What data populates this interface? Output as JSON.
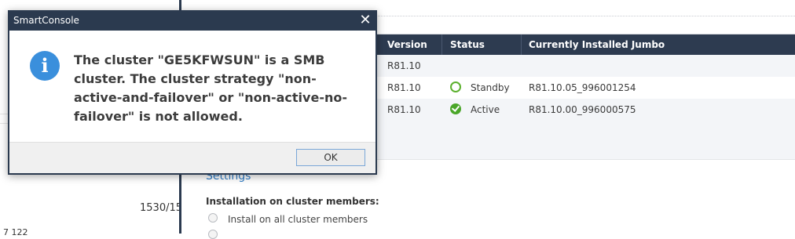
{
  "left_panel": {
    "page_number": "1530/15",
    "fragment_text": "7 122"
  },
  "table": {
    "columns": [
      "Version",
      "Status",
      "Currently Installed Jumbo"
    ],
    "rows": [
      {
        "version": "R81.10",
        "status": "",
        "status_icon": "",
        "jumbo": ""
      },
      {
        "version": "R81.10",
        "status": "Standby",
        "status_icon": "standby-circle-icon",
        "jumbo": "R81.10.05_996001254"
      },
      {
        "version": "R81.10",
        "status": "Active",
        "status_icon": "active-check-icon",
        "jumbo": "R81.10.00_996000575"
      }
    ]
  },
  "settings": {
    "link_label": "Settings",
    "install_label": "Installation on cluster members:",
    "options": [
      "Install on all cluster members"
    ]
  },
  "dialog": {
    "title": "SmartConsole",
    "close_glyph": "✕",
    "icon": "info-icon",
    "message": "The cluster \"GE5KFWSUN\" is a SMB cluster. The cluster strategy \"non-active-and-failover\" or \"non-active-no-failover\" is not allowed.",
    "ok_label": "OK"
  },
  "colors": {
    "titlebar": "#2b3a4f",
    "table_header": "#2d3b50",
    "info_blue": "#3a8fdc",
    "status_green": "#4aa629"
  }
}
